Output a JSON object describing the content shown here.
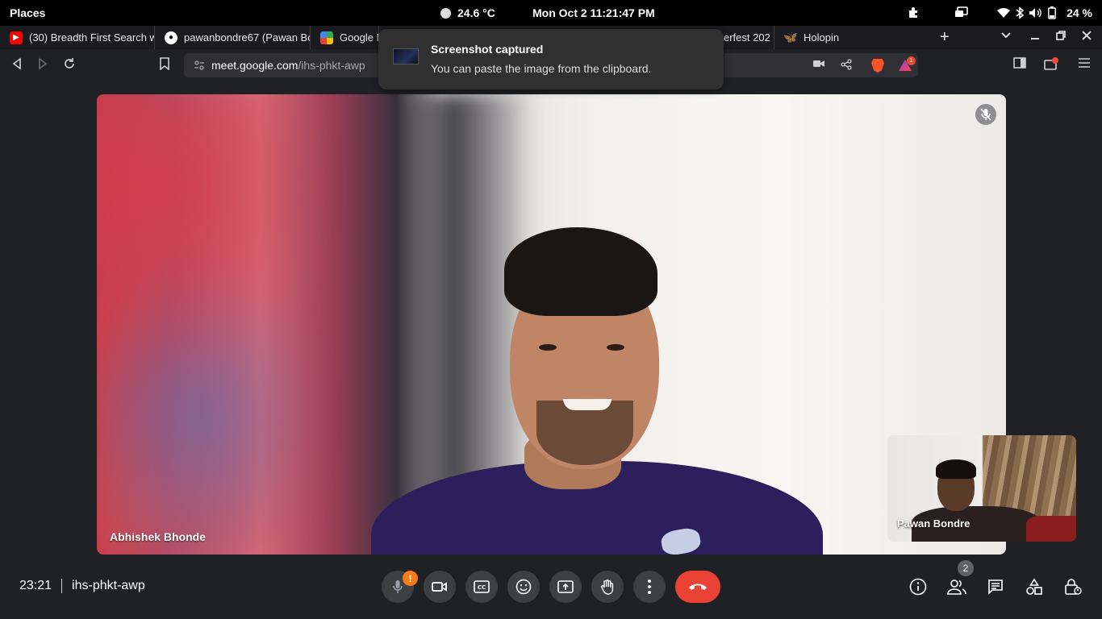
{
  "topbar": {
    "places_label": "Places",
    "weather": "24.6 °C",
    "datetime": "Mon Oct 2  11:21:47 PM",
    "battery_percent": "24 %"
  },
  "tabs": [
    {
      "title": "(30) Breadth First Search w",
      "icon": "youtube-icon"
    },
    {
      "title": "pawanbondre67 (Pawan Bo",
      "icon": "github-icon"
    },
    {
      "title": "Google M",
      "icon": "google-meet-icon"
    },
    {
      "title": "erfest 202",
      "icon": "hacktoberfest-icon"
    },
    {
      "title": "Holopin",
      "icon": "holopin-icon"
    }
  ],
  "toolbar": {
    "url_host": "meet.google.com",
    "url_path": "/ihs-phkt-awp",
    "rewards_badge": "1"
  },
  "notification": {
    "title": "Screenshot captured",
    "body": "You can paste the image from the clipboard."
  },
  "main_participant": {
    "name": "Abhishek Bhonde",
    "muted": true
  },
  "self_view": {
    "name": "Pawan Bondre"
  },
  "meeting": {
    "time": "23:21",
    "code": "ihs-phkt-awp",
    "mic_warning": "!",
    "people_count": "2"
  },
  "colors": {
    "hangup": "#ea4335",
    "control_bg": "#3c4043",
    "warning": "#fa7b17",
    "brave": "#fb542b"
  }
}
